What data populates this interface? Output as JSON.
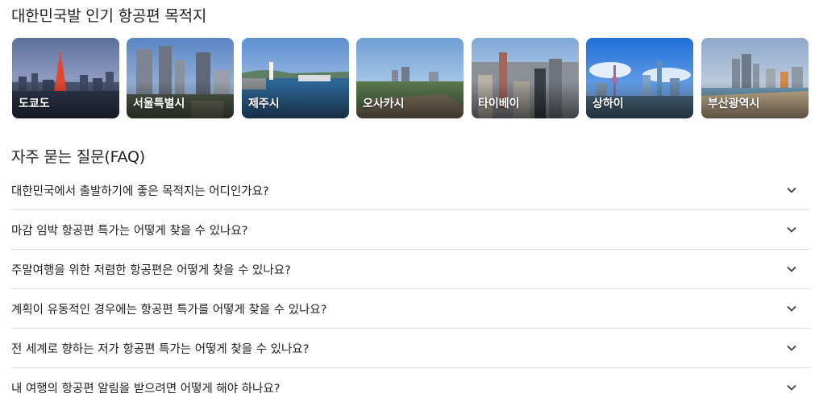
{
  "destinations": {
    "title": "대한민국발 인기 항공편 목적지",
    "cards": [
      {
        "name": "도쿄도"
      },
      {
        "name": "서울특별시"
      },
      {
        "name": "제주시"
      },
      {
        "name": "오사카시"
      },
      {
        "name": "타이베이"
      },
      {
        "name": "상하이"
      },
      {
        "name": "부산광역시"
      }
    ]
  },
  "faq": {
    "title": "자주 묻는 질문(FAQ)",
    "items": [
      {
        "question": "대한민국에서 출발하기에 좋은 목적지는 어디인가요?"
      },
      {
        "question": "마감 임박 항공편 특가는 어떻게 찾을 수 있나요?"
      },
      {
        "question": "주말여행을 위한 저렴한 항공편은 어떻게 찾을 수 있나요?"
      },
      {
        "question": "계획이 유동적인 경우에는 항공편 특가를 어떻게 찾을 수 있나요?"
      },
      {
        "question": "전 세계로 향하는 저가 항공편 특가는 어떻게 찾을 수 있나요?"
      },
      {
        "question": "내 여행의 항공편 알림을 받으려면 어떻게 해야 하나요?"
      }
    ],
    "expand_icon": "chevron-down-icon"
  }
}
